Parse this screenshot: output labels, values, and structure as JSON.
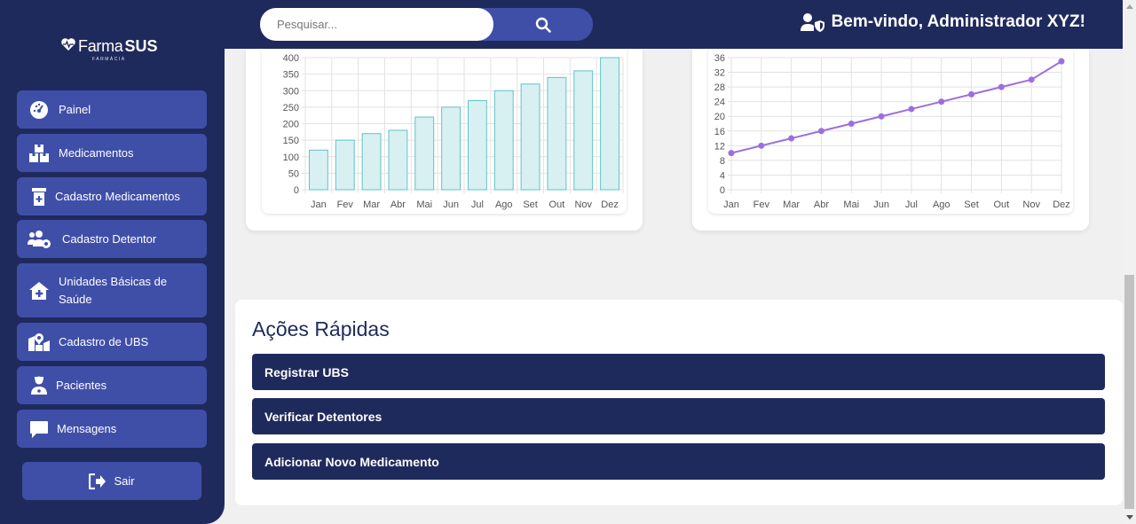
{
  "sidebar": {
    "logo": {
      "farma": "Farma",
      "sus": "SUS",
      "sub": "FARMÁCIA"
    },
    "items": [
      {
        "label": "Painel",
        "icon": "gauge-icon"
      },
      {
        "label": "Medicamentos",
        "icon": "boxes-icon"
      },
      {
        "label": "Cadastro Medicamentos",
        "icon": "prescription-bottle-icon"
      },
      {
        "label": "Cadastro Detentor",
        "icon": "users-gear-icon"
      },
      {
        "label": "Unidades Básicas de Saúde",
        "icon": "house-medical-icon"
      },
      {
        "label": "Cadastro de UBS",
        "icon": "map-location-icon"
      },
      {
        "label": "Pacientes",
        "icon": "user-doctor-icon"
      },
      {
        "label": "Mensagens",
        "icon": "message-icon"
      }
    ],
    "logout_label": "Sair"
  },
  "header": {
    "search_placeholder": "Pesquisar...",
    "welcome": "Bem-vindo, Administrador XYZ!"
  },
  "chart_data": [
    {
      "type": "bar",
      "categories": [
        "Jan",
        "Fev",
        "Mar",
        "Abr",
        "Mai",
        "Jun",
        "Jul",
        "Ago",
        "Set",
        "Out",
        "Nov",
        "Dez"
      ],
      "values": [
        120,
        150,
        170,
        180,
        220,
        250,
        270,
        300,
        320,
        340,
        360,
        400
      ],
      "yticks": [
        0,
        50,
        100,
        150,
        200,
        250,
        300,
        350,
        400
      ],
      "ylim": [
        0,
        400
      ],
      "grid": true,
      "colors": {
        "fill": "#d8f0f2",
        "stroke": "#5fc4c6"
      }
    },
    {
      "type": "line",
      "categories": [
        "Jan",
        "Fev",
        "Mar",
        "Abr",
        "Mai",
        "Jun",
        "Jul",
        "Ago",
        "Set",
        "Out",
        "Nov",
        "Dez"
      ],
      "values": [
        10,
        12,
        14,
        16,
        18,
        20,
        22,
        24,
        26,
        28,
        30,
        35
      ],
      "yticks": [
        0,
        4,
        8,
        12,
        16,
        20,
        24,
        28,
        32,
        36
      ],
      "ylim": [
        0,
        36
      ],
      "grid": true,
      "colors": {
        "line": "#9b6fe0"
      }
    }
  ],
  "quick_actions": {
    "title": "Ações Rápidas",
    "buttons": [
      "Registrar UBS",
      "Verificar Detentores",
      "Adicionar Novo Medicamento"
    ]
  },
  "colors": {
    "navy": "#1f2a5c",
    "accent": "#3f4fa8"
  }
}
